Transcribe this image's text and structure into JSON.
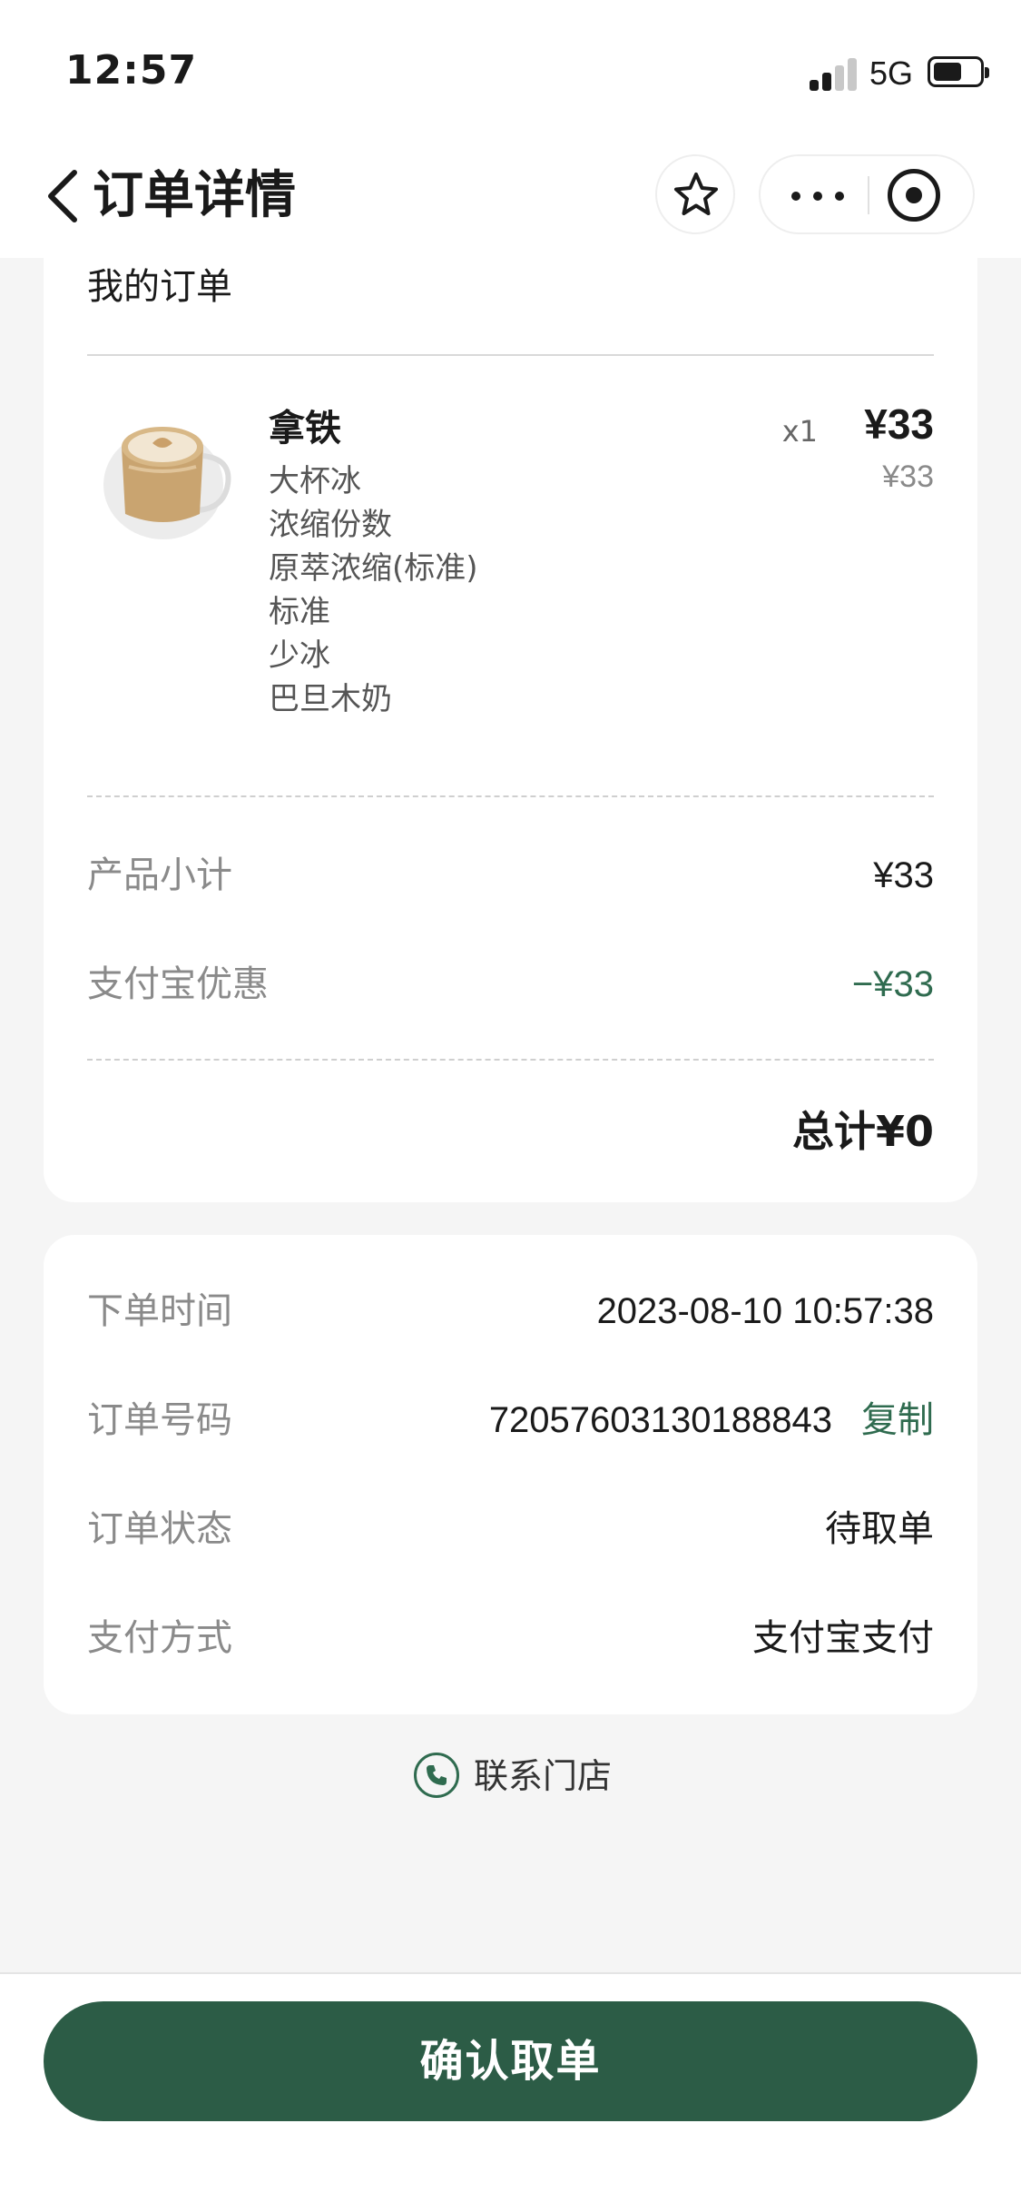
{
  "status_bar": {
    "time": "12:57",
    "network": "5G"
  },
  "nav": {
    "title": "订单详情",
    "icons": [
      "back-icon",
      "star-icon",
      "more-icon",
      "close-miniprogram-icon"
    ]
  },
  "order": {
    "section_title": "我的订单",
    "item": {
      "name": "拿铁",
      "quantity": "x1",
      "price": "¥33",
      "original_price": "¥33",
      "options": [
        "大杯冰",
        "浓缩份数",
        "原萃浓缩(标准)",
        "标准",
        "少冰",
        "巴旦木奶"
      ]
    },
    "subtotal_label": "产品小计",
    "subtotal_value": "¥33",
    "discount_label": "支付宝优惠",
    "discount_value": "−¥33",
    "total": "总计¥0"
  },
  "info": {
    "time_label": "下单时间",
    "time_value": "2023-08-10 10:57:38",
    "order_no_label": "订单号码",
    "order_no_value": "72057603130188843",
    "copy_label": "复制",
    "status_label": "订单状态",
    "status_value": "待取单",
    "payment_label": "支付方式",
    "payment_value": "支付宝支付"
  },
  "contact": {
    "label": "联系门店",
    "icon": "phone-icon"
  },
  "bottom": {
    "confirm_label": "确认取单"
  },
  "colors": {
    "brand_green": "#2c5c46",
    "accent_green": "#2f6b4f",
    "background": "#f5f5f5",
    "label_gray": "#8a8a8a"
  }
}
